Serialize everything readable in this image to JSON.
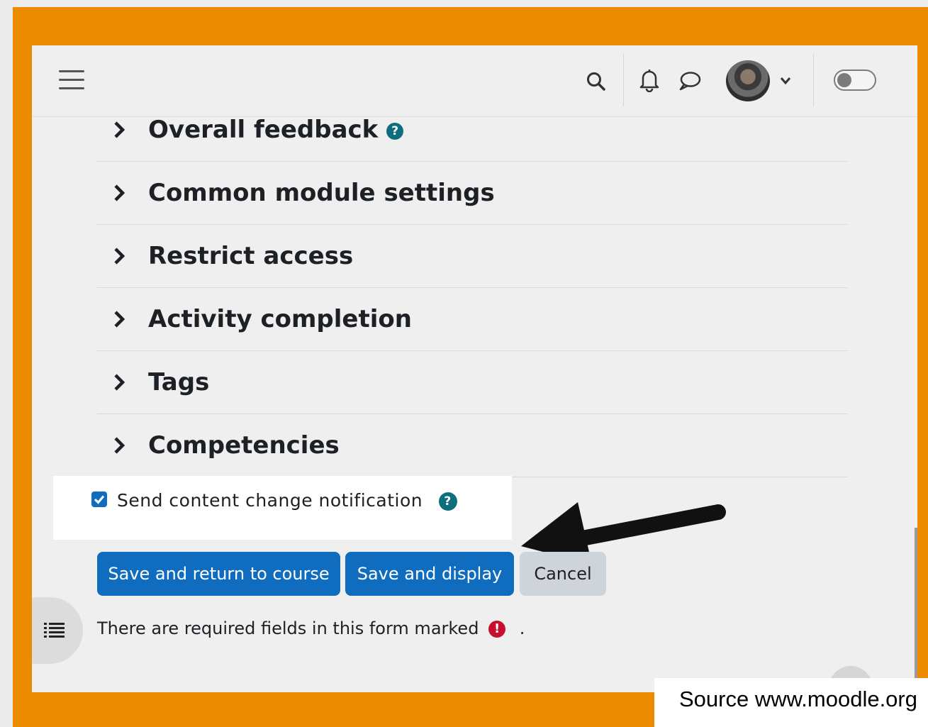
{
  "colors": {
    "frame": "#ec8a00",
    "primary": "#0f6cbf",
    "secondary": "#ced4da",
    "required": "#c8102e"
  },
  "navbar": {
    "icons": [
      "menu-icon",
      "search-icon",
      "bell-icon",
      "chat-icon",
      "avatar",
      "chevron-down-icon",
      "toggle"
    ]
  },
  "sections": [
    {
      "label": "Overall feedback",
      "has_help": true
    },
    {
      "label": "Common module settings"
    },
    {
      "label": "Restrict access"
    },
    {
      "label": "Activity completion"
    },
    {
      "label": "Tags"
    },
    {
      "label": "Competencies"
    }
  ],
  "notification": {
    "label": "Send content change notification",
    "checked": true
  },
  "buttons": {
    "save_return": "Save and return to course",
    "save_display": "Save and display",
    "cancel": "Cancel"
  },
  "required_note": {
    "text": "There are required fields in this form marked",
    "suffix": "."
  },
  "help_glyph": "?",
  "required_glyph": "!",
  "source": "Source www.moodle.org"
}
